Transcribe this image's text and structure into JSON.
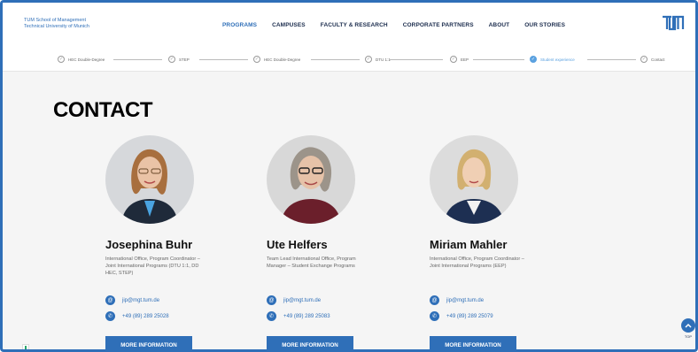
{
  "header": {
    "logo_line1": "TUM School of Management",
    "logo_line2": "Technical University of Munich",
    "nav": [
      {
        "label": "PROGRAMS",
        "active": true
      },
      {
        "label": "CAMPUSES",
        "active": false
      },
      {
        "label": "FACULTY & RESEARCH",
        "active": false
      },
      {
        "label": "CORPORATE PARTNERS",
        "active": false
      },
      {
        "label": "ABOUT",
        "active": false
      },
      {
        "label": "OUR STORIES",
        "active": false
      }
    ]
  },
  "steps": [
    {
      "label": "HEC Double-Degree",
      "active": false
    },
    {
      "label": "STEP",
      "active": false
    },
    {
      "label": "HEC Double-Degree",
      "active": false
    },
    {
      "label": "DTU 1:1",
      "active": false
    },
    {
      "label": "EEP",
      "active": false
    },
    {
      "label": "Student experience",
      "active": true
    },
    {
      "label": "Contact",
      "active": false
    }
  ],
  "page": {
    "heading": "CONTACT"
  },
  "contacts": [
    {
      "name": "Josephina Buhr",
      "role": "International Office, Program Coordinator – Joint International Programs (DTU 1:1, DD HEC, STEP)",
      "email": "jip@mgt.tum.de",
      "phone": "+49 (89) 289 25028",
      "button": "MORE INFORMATION"
    },
    {
      "name": "Ute Helfers",
      "role": "Team Lead International Office, Program Manager – Student Exchange Programs",
      "email": "jip@mgt.tum.de",
      "phone": "+49 (89) 289 25083",
      "button": "MORE INFORMATION"
    },
    {
      "name": "Miriam Mahler",
      "role": "International Office, Program Coordinator – Joint International Programs (EEP)",
      "email": "jip@mgt.tum.de",
      "phone": "+49 (89) 289 25079",
      "button": "MORE INFORMATION"
    }
  ],
  "top_button": {
    "label": "TOP"
  },
  "colors": {
    "accent": "#2f6fb8",
    "active_step": "#5aa1e0",
    "page_bg": "#f5f5f5"
  }
}
